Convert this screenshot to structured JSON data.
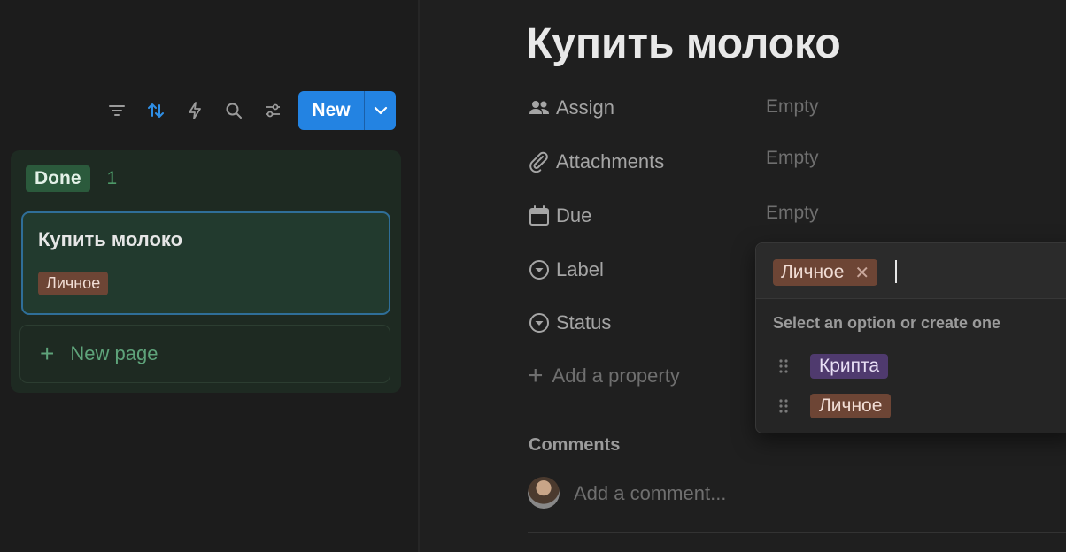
{
  "toolbar": {
    "icons": [
      "filter-icon",
      "sort-icon",
      "lightning-icon",
      "search-icon",
      "settings-sliders-icon"
    ],
    "new_label": "New",
    "accent": "#2383e2"
  },
  "board": {
    "group": {
      "label": "Done",
      "count": "1"
    },
    "card": {
      "title": "Купить молоко",
      "tag": "Личное"
    },
    "new_page_label": "New page"
  },
  "page": {
    "title": "Купить молоко",
    "properties": [
      {
        "label": "Assign",
        "value": "Empty",
        "icon": "people-icon"
      },
      {
        "label": "Attachments",
        "value": "Empty",
        "icon": "paperclip-icon"
      },
      {
        "label": "Due",
        "value": "Empty",
        "icon": "calendar-icon"
      },
      {
        "label": "Label",
        "icon": "select-icon"
      },
      {
        "label": "Status",
        "icon": "select-icon"
      }
    ],
    "add_property": "Add a property",
    "comments": {
      "heading": "Comments",
      "placeholder": "Add a comment..."
    }
  },
  "dropdown": {
    "selected": "Личное",
    "hint": "Select an option or create one",
    "options": [
      {
        "label": "Крипта",
        "color": "#4f3a6e"
      },
      {
        "label": "Личное",
        "color": "#6d4535"
      }
    ]
  }
}
